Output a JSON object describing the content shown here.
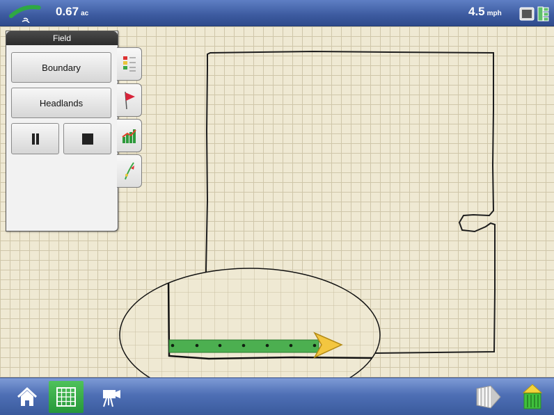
{
  "status_bar": {
    "area_value": "0.67",
    "area_unit": "ac",
    "speed_value": "4.5",
    "speed_unit": "mph",
    "icons": [
      "gps-satellite-icon",
      "display-toggle-icon"
    ]
  },
  "field_panel": {
    "title": "Field",
    "boundary_label": "Boundary",
    "headlands_label": "Headlands",
    "pause_icon": "pause-icon",
    "stop_icon": "stop-icon",
    "tabs": [
      "legend-icon",
      "flag-icon",
      "chart-icon",
      "guidance-icon"
    ]
  },
  "bottom_bar": {
    "items": [
      "home-icon",
      "map-grid-icon",
      "video-camera-icon",
      "implement-icon",
      "product-bin-icon"
    ],
    "active_item": "map-grid-icon"
  },
  "colors": {
    "bar_blue": "#3c5a9f",
    "map_background": "#efe9d3",
    "coverage_green": "#4caf50",
    "vehicle_arrow": "#f3c640",
    "active_nav": "#2fa241"
  }
}
